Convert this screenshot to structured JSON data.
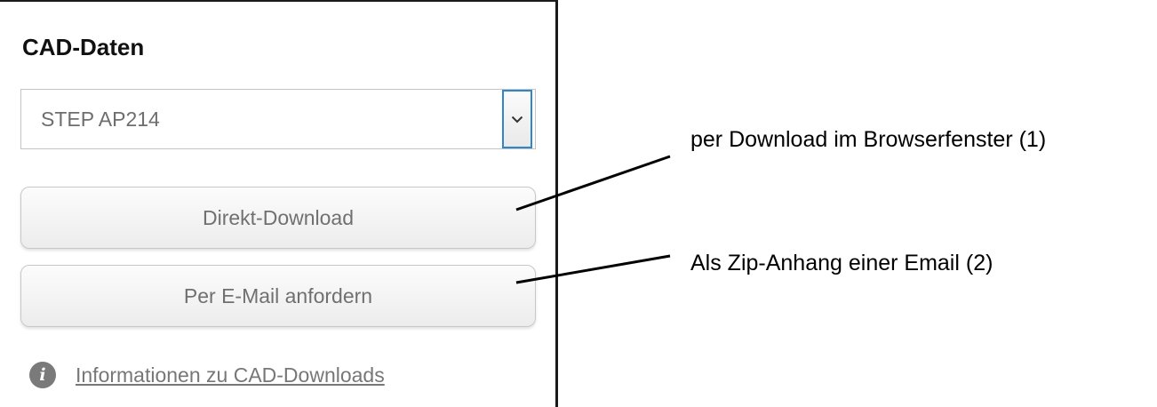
{
  "panel": {
    "title": "CAD-Daten",
    "format_select": {
      "selected": "STEP AP214",
      "arrow_icon": "chevron-down-icon"
    },
    "buttons": {
      "direct_download": "Direkt-Download",
      "email_request": "Per E-Mail anfordern"
    },
    "info": {
      "icon": "info-icon",
      "link_text": "Informationen zu CAD-Downloads"
    }
  },
  "annotations": {
    "callout_1": "per Download im Browserfenster (1)",
    "callout_2": "Als Zip-Anhang einer Email (2)"
  },
  "colors": {
    "select_focus": "#2f86c9",
    "button_text": "#707070",
    "link_text": "#777777"
  }
}
